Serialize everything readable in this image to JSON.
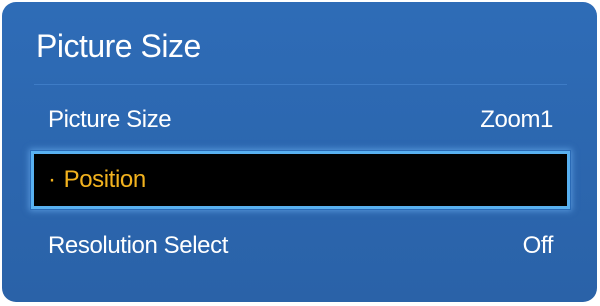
{
  "menu": {
    "title": "Picture Size",
    "items": [
      {
        "label": "Picture Size",
        "value": "Zoom1"
      },
      {
        "bullet": "·",
        "label": "Position",
        "value": ""
      },
      {
        "label": "Resolution Select",
        "value": "Off"
      }
    ],
    "selected_index": 1
  },
  "colors": {
    "panel_background": "#2e6cb7",
    "text": "#ffffff",
    "selected_background": "#000000",
    "selected_text": "#f2b21e",
    "selected_outline": "#58b0f0"
  }
}
